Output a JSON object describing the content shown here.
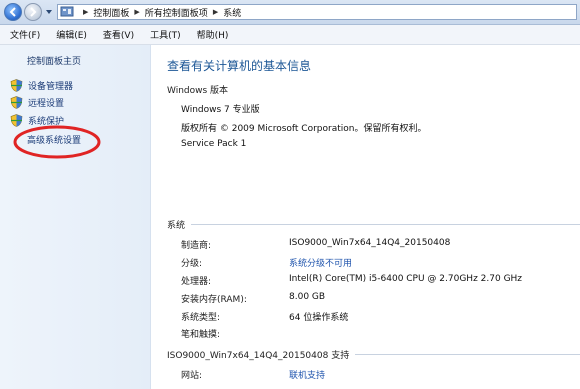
{
  "addressbar": {
    "breadcrumbs": [
      "控制面板",
      "所有控制面板项",
      "系统"
    ]
  },
  "menubar": {
    "items": [
      "文件(F)",
      "编辑(E)",
      "查看(V)",
      "工具(T)",
      "帮助(H)"
    ]
  },
  "sidebar": {
    "home": "控制面板主页",
    "links": [
      "设备管理器",
      "远程设置",
      "系统保护",
      "高级系统设置"
    ],
    "highlight_color": "#e02424"
  },
  "main": {
    "title": "查看有关计算机的基本信息",
    "windows_edition": {
      "heading": "Windows 版本",
      "edition": "Windows 7 专业版",
      "copyright": "版权所有 © 2009 Microsoft Corporation。保留所有权利。",
      "service_pack": "Service Pack 1"
    },
    "system": {
      "heading": "系统",
      "rows": [
        {
          "label": "制造商:",
          "value": "ISO9000_Win7x64_14Q4_20150408"
        },
        {
          "label": "分级:",
          "value": "系统分级不可用"
        },
        {
          "label": "处理器:",
          "value": "Intel(R) Core(TM) i5-6400 CPU @ 2.70GHz   2.70 GHz"
        },
        {
          "label": "安装内存(RAM):",
          "value": "8.00 GB"
        },
        {
          "label": "系统类型:",
          "value": "64 位操作系统"
        },
        {
          "label": "笔和触摸:",
          "value": ""
        }
      ]
    },
    "support": {
      "heading": "ISO9000_Win7x64_14Q4_20150408 支持",
      "rows": [
        {
          "label": "网站:",
          "value": "联机支持"
        }
      ]
    }
  },
  "colors": {
    "link": "#1f54ad",
    "title": "#1d5796"
  }
}
